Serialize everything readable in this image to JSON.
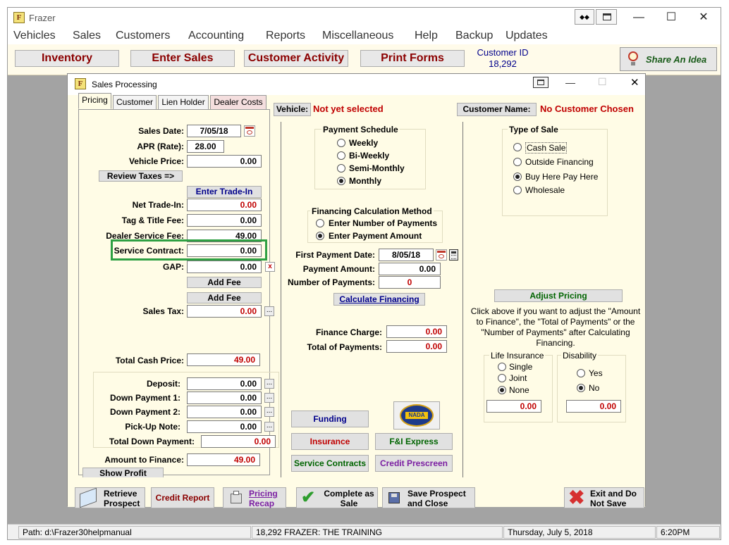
{
  "app": {
    "title": "Frazer",
    "logo_letter": "F",
    "restore_icon": "◆◆"
  },
  "menu": [
    "Vehicles",
    "Sales",
    "Customers",
    "Accounting",
    "Reports",
    "Miscellaneous",
    "Help",
    "Backup",
    "Updates"
  ],
  "toolbar": {
    "inventory": "Inventory",
    "enter_sales": "Enter Sales",
    "customer_activity": "Customer Activity",
    "print_forms": "Print Forms",
    "customer_id_label": "Customer ID",
    "customer_id_value": "18,292",
    "share_idea": "Share An Idea"
  },
  "dialog": {
    "title": "Sales Processing",
    "tabs": [
      "Pricing",
      "Customer",
      "Lien Holder",
      "Dealer Costs"
    ],
    "vehicle_label": "Vehicle:",
    "vehicle_value": "Not yet selected",
    "customer_name_label": "Customer Name:",
    "customer_name_value": "No Customer Chosen",
    "pricing": {
      "sales_date_label": "Sales Date:",
      "sales_date": "7/05/18",
      "apr_label": "APR (Rate):",
      "apr": "28.00",
      "vehicle_price_label": "Vehicle Price:",
      "vehicle_price": "0.00",
      "review_taxes": "Review Taxes =>",
      "enter_tradein": "Enter Trade-In",
      "net_tradein_label": "Net Trade-In:",
      "net_tradein": "0.00",
      "tag_title_label": "Tag & Title Fee:",
      "tag_title": "0.00",
      "dealer_service_label": "Dealer Service Fee:",
      "dealer_service": "49.00",
      "service_contract_label": "Service Contract:",
      "service_contract": "0.00",
      "gap_label": "GAP:",
      "gap": "0.00",
      "gap_x": "x",
      "add_fee_1": "Add Fee",
      "add_fee_2": "Add Fee",
      "sales_tax_label": "Sales Tax:",
      "sales_tax": "0.00",
      "total_cash_label": "Total Cash Price:",
      "total_cash": "49.00",
      "deposit_label": "Deposit:",
      "deposit": "0.00",
      "down1_label": "Down Payment 1:",
      "down1": "0.00",
      "down2_label": "Down Payment 2:",
      "down2": "0.00",
      "pickup_label": "Pick-Up Note:",
      "pickup": "0.00",
      "total_down_label": "Total Down Payment:",
      "total_down": "0.00",
      "amount_finance_label": "Amount to Finance:",
      "amount_finance": "49.00",
      "show_profit": "Show Profit",
      "ellipsis": "..."
    },
    "schedule": {
      "title": "Payment Schedule",
      "options": [
        "Weekly",
        "Bi-Weekly",
        "Semi-Monthly",
        "Monthly"
      ],
      "selected": 3
    },
    "calc_method": {
      "title": "Financing Calculation Method",
      "options": [
        "Enter Number of Payments",
        "Enter Payment Amount"
      ],
      "selected": 1
    },
    "first_payment_label": "First Payment Date:",
    "first_payment": "8/05/18",
    "payment_amount_label": "Payment Amount:",
    "payment_amount": "0.00",
    "num_payments_label": "Number of Payments:",
    "num_payments": "0",
    "calculate_financing": "Calculate Financing",
    "finance_charge_label": "Finance Charge:",
    "finance_charge": "0.00",
    "total_payments_label": "Total of Payments:",
    "total_payments": "0.00",
    "mid_buttons": {
      "funding": "Funding",
      "nada": "NADA",
      "insurance": "Insurance",
      "fi_express": "F&I Express",
      "service_contracts": "Service Contracts",
      "credit_prescreen": "Credit Prescreen"
    },
    "type_of_sale": {
      "title": "Type of Sale",
      "options": [
        "Cash Sale",
        "Outside Financing",
        "Buy Here Pay Here",
        "Wholesale"
      ],
      "selected": 2
    },
    "adjust_pricing": "Adjust Pricing",
    "adjust_help": "Click above if you want to adjust the \"Amount to Finance\", the \"Total of Payments\" or the \"Number of Payments\" after Calculating Financing.",
    "life_insurance": {
      "title": "Life Insurance",
      "options": [
        "Single",
        "Joint",
        "None"
      ],
      "selected": 2,
      "value": "0.00"
    },
    "disability": {
      "title": "Disability",
      "options": [
        "Yes",
        "No"
      ],
      "selected": 1,
      "value": "0.00"
    },
    "bottom": {
      "retrieve_1": "Retrieve",
      "retrieve_2": "Prospect",
      "credit_report": "Credit Report",
      "pricing_1": "Pricing",
      "pricing_2": "Recap",
      "complete_1": "Complete as",
      "complete_2": "Sale",
      "save_1": "Save Prospect",
      "save_2": "and Close",
      "exit_1": "Exit and Do",
      "exit_2": "Not Save"
    }
  },
  "status": {
    "path": "Path: d:\\Frazer30helpmanual",
    "user": "18,292  FRAZER: THE TRAINING",
    "date": "Thursday, July  5, 2018",
    "time": "6:20PM"
  },
  "colors": {
    "highlight": "#2ea043",
    "dark_red": "#8b0000",
    "red": "#c00000",
    "blue": "#00008b",
    "green": "#006400",
    "purple": "#7b1fa2"
  }
}
